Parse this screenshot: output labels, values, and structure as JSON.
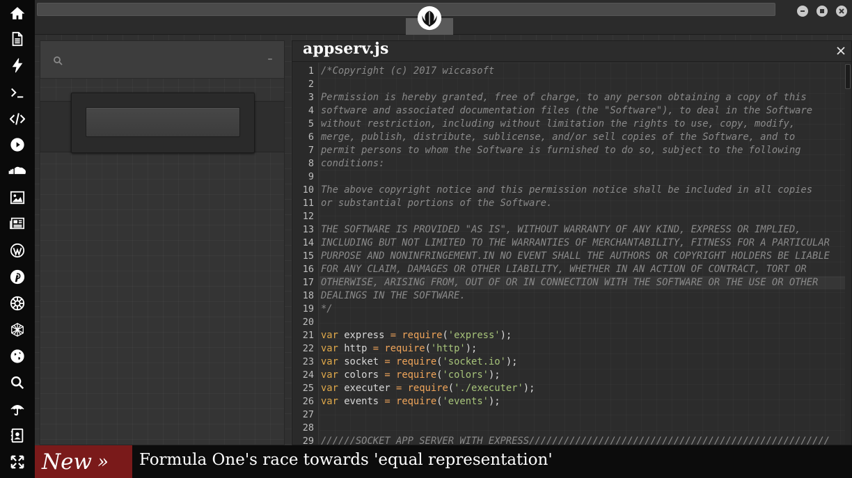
{
  "dock": {
    "items": [
      {
        "icon": "home-icon"
      },
      {
        "icon": "document-icon"
      },
      {
        "icon": "lightning-icon"
      },
      {
        "icon": "terminal-icon"
      },
      {
        "icon": "code-icon"
      },
      {
        "icon": "play-icon"
      },
      {
        "icon": "soundcloud-icon"
      },
      {
        "icon": "image-icon"
      },
      {
        "icon": "newspaper-icon"
      },
      {
        "icon": "wordpress-icon"
      },
      {
        "icon": "pinterest-icon"
      },
      {
        "icon": "galactic-empire-icon"
      },
      {
        "icon": "hexagon-network-icon"
      },
      {
        "icon": "globe-icon"
      },
      {
        "icon": "search-icon"
      },
      {
        "icon": "umbrella-icon"
      },
      {
        "icon": "contacts-icon"
      },
      {
        "icon": "expand-icon"
      }
    ]
  },
  "topbar": {
    "logo_icon": "rebel-alliance-icon",
    "window_buttons": [
      "minimize-icon",
      "maximize-icon",
      "close-icon"
    ]
  },
  "panel": {
    "search_placeholder": "",
    "collapse_label": "–"
  },
  "editor": {
    "filename": "appserv.js",
    "close_label": "✕",
    "active_line": 17,
    "lines": [
      {
        "n": "1",
        "t": "/*Copyright (c) 2017 wiccasoft"
      },
      {
        "n": "2",
        "t": ""
      },
      {
        "n": "3",
        "t": "Permission is hereby granted, free of charge, to any person obtaining a copy of this"
      },
      {
        "n": "4",
        "t": "software and associated documentation files (the \"Software\"), to deal in the Software"
      },
      {
        "n": "5",
        "t": "without restriction, including without limitation the rights to use, copy, modify,"
      },
      {
        "n": "6",
        "t": "merge, publish, distribute, sublicense, and/or sell copies of the Software, and to"
      },
      {
        "n": "7",
        "t": "permit persons to whom the Software is furnished to do so, subject to the following"
      },
      {
        "n": "8",
        "t": "conditions:"
      },
      {
        "n": "9",
        "t": ""
      },
      {
        "n": "10",
        "t": "The above copyright notice and this permission notice shall be included in all copies"
      },
      {
        "n": "11",
        "t": "or substantial portions of the Software."
      },
      {
        "n": "12",
        "t": ""
      },
      {
        "n": "13",
        "t": "THE SOFTWARE IS PROVIDED \"AS IS\", WITHOUT WARRANTY OF ANY KIND, EXPRESS OR IMPLIED,"
      },
      {
        "n": "14",
        "t": "INCLUDING BUT NOT LIMITED TO THE WARRANTIES OF MERCHANTABILITY, FITNESS FOR A PARTICULAR"
      },
      {
        "n": "15",
        "t": "PURPOSE AND NONINFRINGEMENT.IN NO EVENT SHALL THE AUTHORS OR COPYRIGHT HOLDERS BE LIABLE"
      },
      {
        "n": "16",
        "t": "FOR ANY CLAIM, DAMAGES OR OTHER LIABILITY, WHETHER IN AN ACTION OF CONTRACT, TORT OR"
      },
      {
        "n": "17",
        "t": "OTHERWISE, ARISING FROM, OUT OF OR IN CONNECTION WITH THE SOFTWARE OR THE USE OR OTHER"
      },
      {
        "n": "18",
        "t": "DEALINGS IN THE SOFTWARE."
      },
      {
        "n": "19",
        "t": "*/"
      },
      {
        "n": "20",
        "t": ""
      },
      {
        "n": "21",
        "kw": "var",
        "id": "express",
        "op": "=",
        "fn": "require",
        "str": "'express'"
      },
      {
        "n": "22",
        "kw": "var",
        "id": "http",
        "op": "=",
        "fn": "require",
        "str": "'http'"
      },
      {
        "n": "23",
        "kw": "var",
        "id": "socket",
        "op": "=",
        "fn": "require",
        "str": "'socket.io'"
      },
      {
        "n": "24",
        "kw": "var",
        "id": "colors",
        "op": "=",
        "fn": "require",
        "str": "'colors'"
      },
      {
        "n": "25",
        "kw": "var",
        "id": "executer",
        "op": "=",
        "fn": "require",
        "str": "'./executer'"
      },
      {
        "n": "26",
        "kw": "var",
        "id": "events",
        "op": "=",
        "fn": "require",
        "str": "'events'"
      },
      {
        "n": "27",
        "t": ""
      },
      {
        "n": "28",
        "t": ""
      },
      {
        "n": "29",
        "t": "//////SOCKET APP SERVER WITH EXPRESS////////////////////////////////////////////////////"
      }
    ]
  },
  "ticker": {
    "badge_label": "New",
    "badge_arrow": "»",
    "headline": "Formula One's race towards 'equal representation'"
  }
}
